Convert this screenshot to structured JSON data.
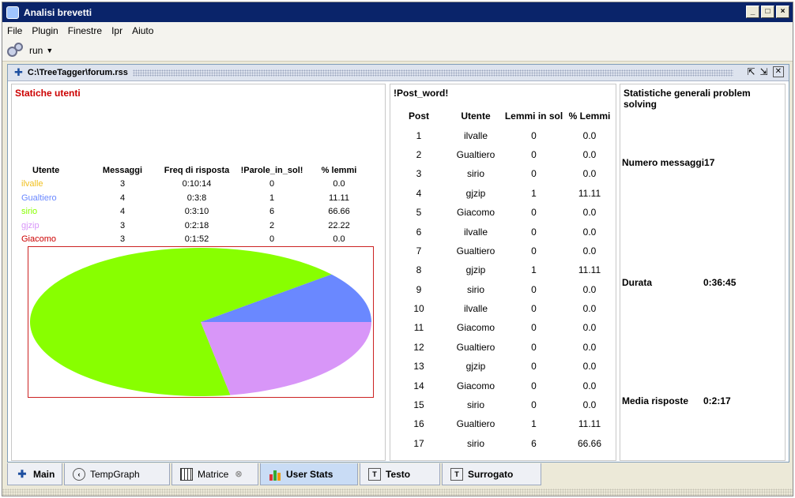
{
  "window": {
    "title": "Analisi brevetti",
    "buttons": [
      "_",
      "□",
      "×"
    ]
  },
  "menu": [
    "File",
    "Plugin",
    "Finestre",
    "Ipr",
    "Aiuto"
  ],
  "toolbar": {
    "run_label": "run"
  },
  "document": {
    "title": "C:\\TreeTagger\\forum.rss"
  },
  "user_stats": {
    "title": "Statiche utenti",
    "headers": [
      "Utente",
      "Messaggi",
      "Freq di risposta",
      "!Parole_in_sol!",
      "% lemmi"
    ],
    "rows": [
      {
        "utente": "ilvalle",
        "messaggi": "3",
        "freq": "0:10:14",
        "parole": "0",
        "lemmi": "0.0",
        "color": "#f0c020"
      },
      {
        "utente": "Gualtiero",
        "messaggi": "4",
        "freq": "0:3:8",
        "parole": "1",
        "lemmi": "11.11",
        "color": "#6a88ff"
      },
      {
        "utente": "sirio",
        "messaggi": "4",
        "freq": "0:3:10",
        "parole": "6",
        "lemmi": "66.66",
        "color": "#88ff00"
      },
      {
        "utente": "gjzip",
        "messaggi": "3",
        "freq": "0:2:18",
        "parole": "2",
        "lemmi": "22.22",
        "color": "#d896f8"
      },
      {
        "utente": "Giacomo",
        "messaggi": "3",
        "freq": "0:1:52",
        "parole": "0",
        "lemmi": "0.0",
        "color": "#cc0000"
      }
    ]
  },
  "chart_data": {
    "type": "pie",
    "categories": [
      "ilvalle",
      "Gualtiero",
      "sirio",
      "gjzip",
      "Giacomo"
    ],
    "values": [
      0.0,
      11.11,
      66.66,
      22.22,
      0.0
    ],
    "colors": [
      "#f0c020",
      "#6a88ff",
      "#88ff00",
      "#d896f8",
      "#cc0000"
    ]
  },
  "post_word": {
    "title": "!Post_word!",
    "headers": [
      "Post",
      "Utente",
      "Lemmi in sol",
      "% Lemmi"
    ],
    "rows": [
      [
        "1",
        "ilvalle",
        "0",
        "0.0"
      ],
      [
        "2",
        "Gualtiero",
        "0",
        "0.0"
      ],
      [
        "3",
        "sirio",
        "0",
        "0.0"
      ],
      [
        "4",
        "gjzip",
        "1",
        "11.11"
      ],
      [
        "5",
        "Giacomo",
        "0",
        "0.0"
      ],
      [
        "6",
        "ilvalle",
        "0",
        "0.0"
      ],
      [
        "7",
        "Gualtiero",
        "0",
        "0.0"
      ],
      [
        "8",
        "gjzip",
        "1",
        "11.11"
      ],
      [
        "9",
        "sirio",
        "0",
        "0.0"
      ],
      [
        "10",
        "ilvalle",
        "0",
        "0.0"
      ],
      [
        "11",
        "Giacomo",
        "0",
        "0.0"
      ],
      [
        "12",
        "Gualtiero",
        "0",
        "0.0"
      ],
      [
        "13",
        "gjzip",
        "0",
        "0.0"
      ],
      [
        "14",
        "Giacomo",
        "0",
        "0.0"
      ],
      [
        "15",
        "sirio",
        "0",
        "0.0"
      ],
      [
        "16",
        "Gualtiero",
        "1",
        "11.11"
      ],
      [
        "17",
        "sirio",
        "6",
        "66.66"
      ]
    ]
  },
  "general_stats": {
    "title": "Statistiche generali problem solving",
    "messages_label": "Numero messaggi17",
    "durata_label": "Durata",
    "durata_value": "0:36:45",
    "media_label": "Media risposte",
    "media_value": "0:2:17"
  },
  "tabs": [
    {
      "label": "Main",
      "icon": "pin-icon"
    },
    {
      "label": "TempGraph",
      "icon": "clock-icon"
    },
    {
      "label": "Matrice",
      "icon": "grid-icon"
    },
    {
      "label": "User Stats",
      "icon": "bar-chart-icon"
    },
    {
      "label": "Testo",
      "icon": "text-icon"
    },
    {
      "label": "Surrogato",
      "icon": "text-icon"
    }
  ]
}
